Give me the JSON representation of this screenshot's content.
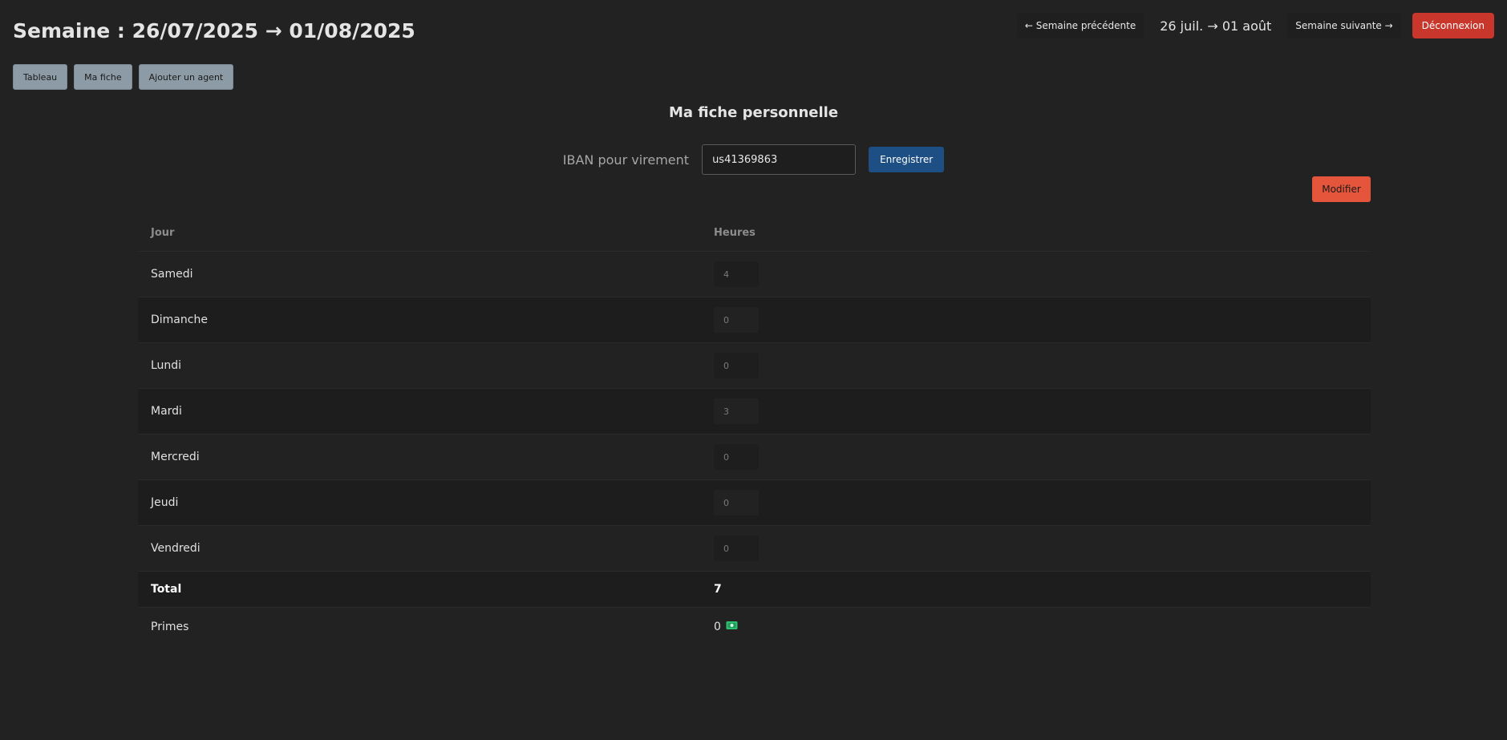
{
  "header": {
    "week_title": "Semaine : 26/07/2025 → 01/08/2025",
    "prev_week_label": "← Semaine précédente",
    "week_range": "26 juil. → 01 août",
    "next_week_label": "Semaine suivante →",
    "logout_label": "Déconnexion"
  },
  "tabs": [
    {
      "label": "Tableau"
    },
    {
      "label": "Ma fiche"
    },
    {
      "label": "Ajouter un agent"
    }
  ],
  "sheet": {
    "title": "Ma fiche personnelle",
    "iban_label": "IBAN pour virement",
    "iban_value": "us41369863",
    "save_label": "Enregistrer",
    "edit_label": "Modifier"
  },
  "table": {
    "col_day": "Jour",
    "col_hours": "Heures",
    "rows": [
      {
        "day": "Samedi",
        "hours": "4"
      },
      {
        "day": "Dimanche",
        "hours": "0"
      },
      {
        "day": "Lundi",
        "hours": "0"
      },
      {
        "day": "Mardi",
        "hours": "3"
      },
      {
        "day": "Mercredi",
        "hours": "0"
      },
      {
        "day": "Jeudi",
        "hours": "0"
      },
      {
        "day": "Vendredi",
        "hours": "0"
      }
    ],
    "total_label": "Total",
    "total_value": "7",
    "primes_label": "Primes",
    "primes_value": "0",
    "primes_icon": "cash-icon"
  },
  "colors": {
    "background": "#222222",
    "logout": "#c9372c",
    "save": "#1d4f85",
    "edit": "#e5553b",
    "tab": "#8c9ba5"
  }
}
